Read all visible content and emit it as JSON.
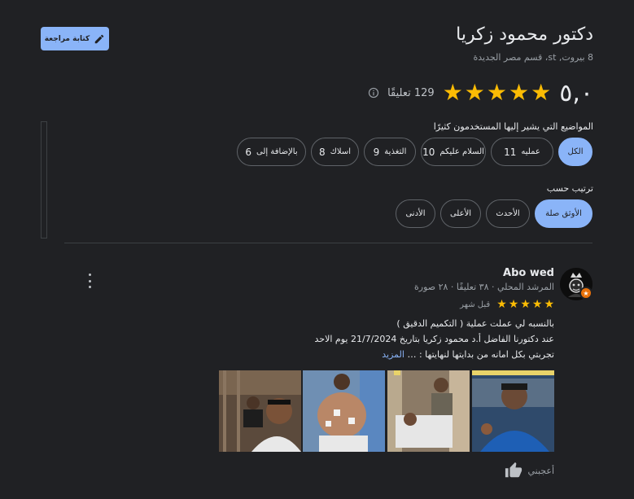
{
  "header": {
    "write_review_label": "كتابة مراجعة",
    "title": "دكتور محمود زكريا",
    "address": "8 بيروت, st، قسم مصر الجديدة"
  },
  "rating": {
    "score": "٥,٠",
    "stars": 5,
    "review_count_text": "129 تعليقًا"
  },
  "topics": {
    "heading": "المواضيع التي يشير إليها المستخدمون كثيرًا",
    "chips": [
      {
        "label": "الكل",
        "count": "",
        "active": true
      },
      {
        "label": "عمليه",
        "count": "11",
        "active": false
      },
      {
        "label": "السلام عليكم",
        "count": "10",
        "active": false
      },
      {
        "label": "التغذية",
        "count": "9",
        "active": false
      },
      {
        "label": "اسلاك",
        "count": "8",
        "active": false
      },
      {
        "label": "بالإضافة إلى",
        "count": "6",
        "active": false
      }
    ]
  },
  "sort": {
    "heading": "ترتيب حسب",
    "options": [
      {
        "label": "الأوثق صلة",
        "active": true
      },
      {
        "label": "الأحدث",
        "active": false
      },
      {
        "label": "الأعلى",
        "active": false
      },
      {
        "label": "الأدنى",
        "active": false
      }
    ]
  },
  "review": {
    "author": "Abo wed",
    "meta": "المرشد المحلي · ٣٨ تعليقًا · ٢٨ صورة",
    "stars": 5,
    "time": "قبل شهر",
    "lines": [
      "بالنسبه لي عملت عملية ( التكميم الدقيق )",
      "عند دكتورنا الفاضل أ.د محمود زكريا بتاريخ 21/7/2024 يوم الاحد",
      "تجربتي بكل امانه من بدايتها لنهايتها : …"
    ],
    "more_label": "المزيد",
    "like_label": "أعجبني"
  },
  "colors": {
    "background": "#202124",
    "accent": "#8ab4f8",
    "star": "#fbbc04",
    "muted_text": "#9aa0a6"
  },
  "icons": {
    "write": "pencil-icon",
    "info": "info-icon",
    "menu": "more-vert-icon",
    "like": "thumb-up-icon",
    "badge": "local-guide-star-icon"
  }
}
